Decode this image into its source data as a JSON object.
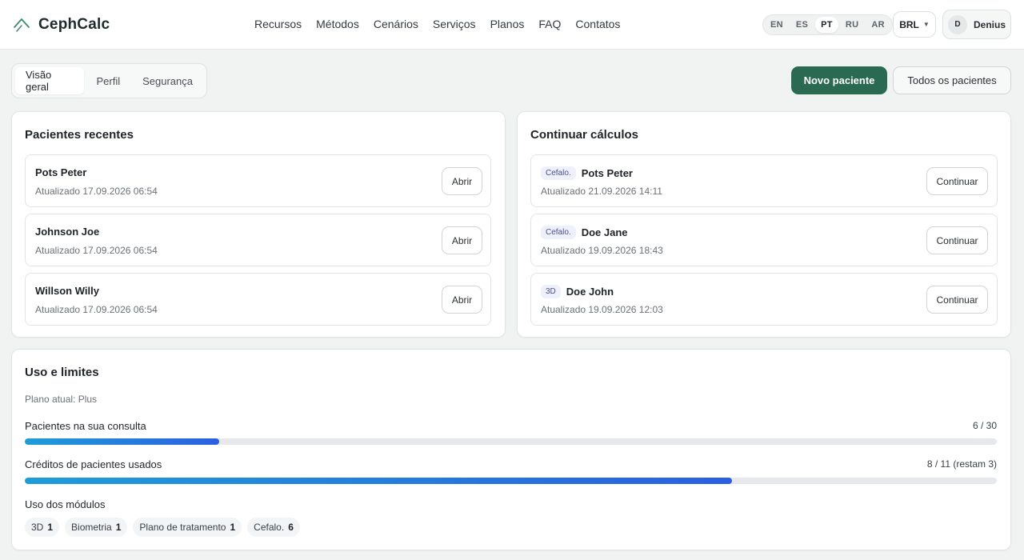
{
  "app": {
    "name": "CephCalc"
  },
  "nav": [
    "Recursos",
    "Métodos",
    "Cenários",
    "Serviços",
    "Planos",
    "FAQ",
    "Contatos"
  ],
  "languages": {
    "options": [
      "EN",
      "ES",
      "PT",
      "RU",
      "AR"
    ],
    "active": "PT"
  },
  "currency": {
    "value": "BRL"
  },
  "user": {
    "initial": "D",
    "name": "Denius"
  },
  "tabs": [
    {
      "label": "Visão geral",
      "active": true
    },
    {
      "label": "Perfil",
      "active": false
    },
    {
      "label": "Segurança",
      "active": false
    }
  ],
  "actions": {
    "new_patient": "Novo paciente",
    "all_patients": "Todos os pacientes"
  },
  "recent": {
    "title": "Pacientes recentes",
    "items": [
      {
        "name": "Pots Peter",
        "updated": "Atualizado 17.09.2026 06:54",
        "action": "Abrir"
      },
      {
        "name": "Johnson Joe",
        "updated": "Atualizado 17.09.2026 06:54",
        "action": "Abrir"
      },
      {
        "name": "Willson Willy",
        "updated": "Atualizado 17.09.2026 06:54",
        "action": "Abrir"
      }
    ]
  },
  "continue": {
    "title": "Continuar cálculos",
    "items": [
      {
        "tag": "Cefalo.",
        "name": "Pots Peter",
        "updated": "Atualizado 21.09.2026 14:11",
        "action": "Continuar"
      },
      {
        "tag": "Cefalo.",
        "name": "Doe Jane",
        "updated": "Atualizado 19.09.2026 18:43",
        "action": "Continuar"
      },
      {
        "tag": "3D",
        "name": "Doe John",
        "updated": "Atualizado 19.09.2026 12:03",
        "action": "Continuar"
      }
    ]
  },
  "usage": {
    "title": "Uso e limites",
    "plan": "Plano atual: Plus",
    "patients": {
      "label": "Pacientes na sua consulta",
      "value": "6 / 30",
      "fraction": 0.2
    },
    "credits": {
      "label": "Créditos de pacientes usados",
      "value": "8 / 11 (restam 3)",
      "fraction": 0.7273
    },
    "modules_label": "Uso dos módulos",
    "modules": [
      {
        "name": "3D",
        "count": "1"
      },
      {
        "name": "Biometria",
        "count": "1"
      },
      {
        "name": "Plano de tratamento",
        "count": "1"
      },
      {
        "name": "Cefalo.",
        "count": "6"
      }
    ]
  },
  "colors": {
    "primary": "#2a6a52",
    "bar_start": "#1e9dd9",
    "bar_end": "#2b5fe0"
  },
  "icons": {
    "logo": "chevron-up-logo-icon",
    "currency_caret": "caret-down-icon"
  }
}
